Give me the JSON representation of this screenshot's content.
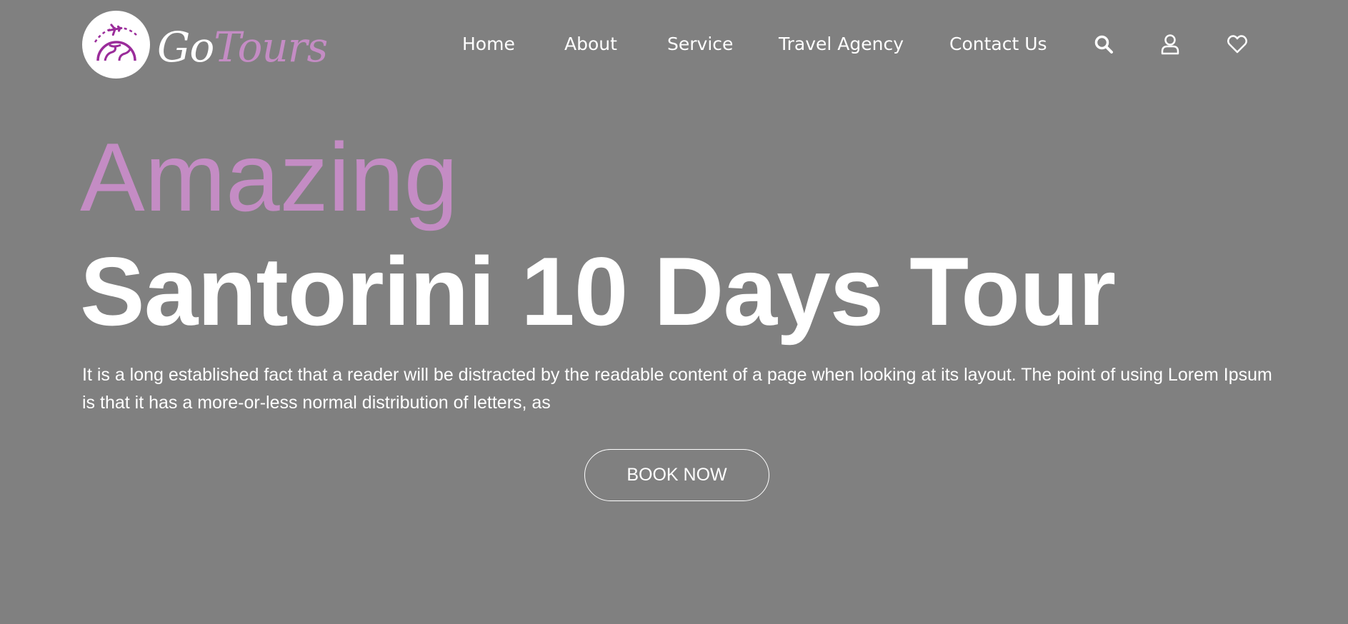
{
  "brand": {
    "name_part1": "Go",
    "name_part2": "Tours",
    "accent_color": "#c48cc4",
    "logo_icon": "globe-airplane-icon"
  },
  "nav": {
    "links": [
      {
        "label": "Home"
      },
      {
        "label": "About"
      },
      {
        "label": "Service"
      },
      {
        "label": "Travel Agency"
      },
      {
        "label": "Contact Us"
      }
    ],
    "icons": [
      "search-icon",
      "user-icon",
      "heart-icon"
    ]
  },
  "hero": {
    "accent_text": "Amazing",
    "title": "Santorini 10 Days Tour",
    "description": "It is a long established fact that a reader will be distracted by the readable content of a page when looking at its layout. The point of using Lorem Ipsum is that it has a more-or-less normal distribution of letters, as",
    "cta_label": "BOOK NOW"
  },
  "colors": {
    "background": "#808080",
    "text": "#ffffff",
    "accent": "#c48cc4"
  }
}
